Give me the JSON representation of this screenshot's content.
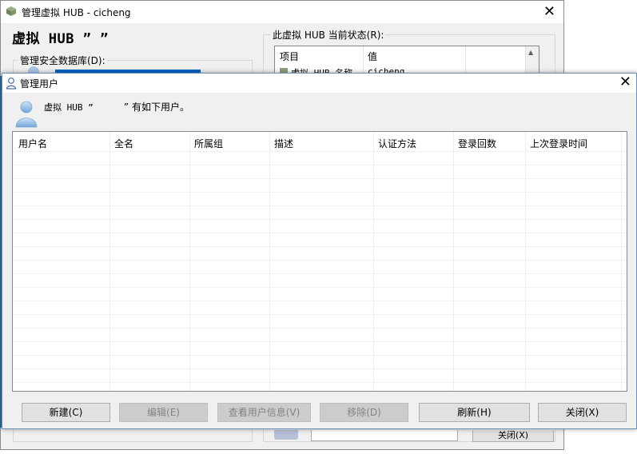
{
  "background_window": {
    "title": "管理虚拟 HUB - cicheng",
    "heading": "虚拟 HUB ”          ”",
    "database_label": "管理安全数据库(D):",
    "status_label": "此虚拟 HUB 当前状态(R):",
    "status_columns": [
      "项目",
      "值"
    ],
    "status_row": {
      "item": "虚拟 HUB 名称",
      "value": "cicheng"
    },
    "close_button": "关闭(X)"
  },
  "dialog": {
    "title": "管理用户",
    "info_prefix": "虚拟 HUB ”",
    "info_suffix": "” 有如下用户。",
    "columns": [
      "用户名",
      "全名",
      "所属组",
      "描述",
      "认证方法",
      "登录回数",
      "上次登录时间"
    ],
    "rows": [],
    "buttons": {
      "new": "新建(C)",
      "edit": "编辑(E)",
      "view_info": "查看用户信息(V)",
      "remove": "移除(D)",
      "refresh": "刷新(H)",
      "close": "关闭(X)"
    }
  },
  "icons": {
    "hub_icon": "cube-icon",
    "user_icon": "user-icon",
    "close_icon": "close-icon"
  }
}
